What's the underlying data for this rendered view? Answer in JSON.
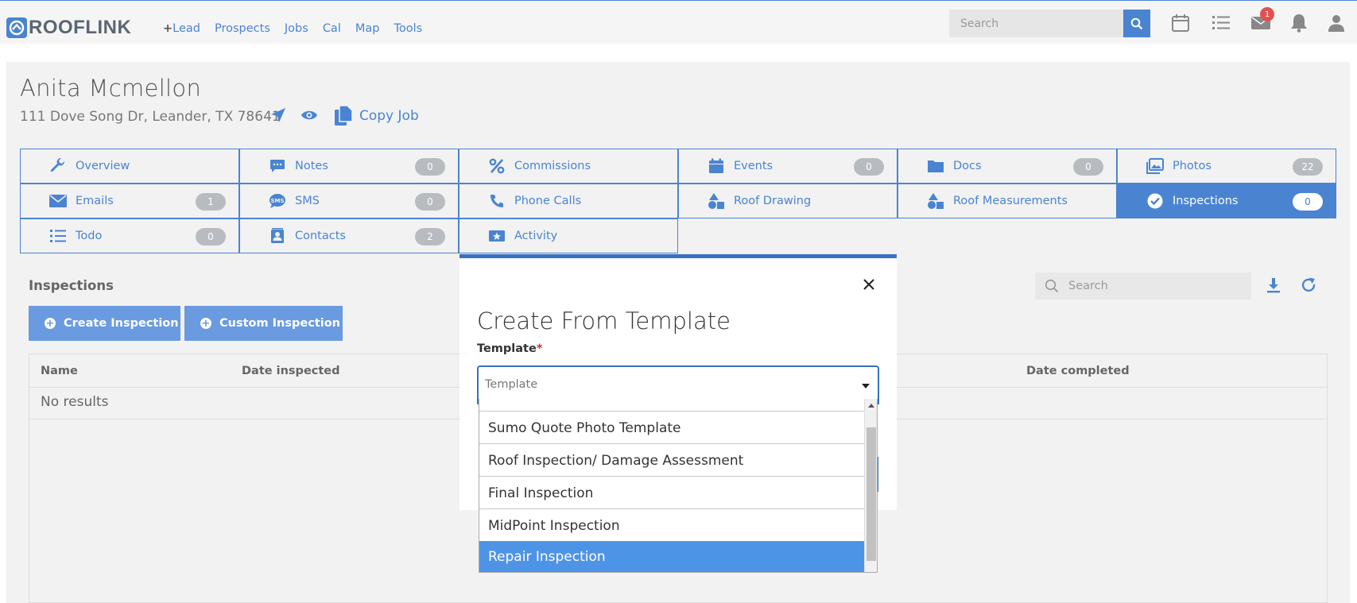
{
  "brand": {
    "name": "ROOFLINK",
    "color": "#4a84d1"
  },
  "nav": {
    "lead_plus": "+",
    "lead_label": "Lead",
    "items": [
      "Prospects",
      "Jobs",
      "Cal",
      "Map",
      "Tools"
    ]
  },
  "top_search": {
    "placeholder": "Search"
  },
  "notifications": {
    "mail_count": "1"
  },
  "customer": {
    "name": "Anita Mcmellon",
    "address": "111 Dove Song Dr, Leander, TX 78641",
    "copy_job_label": "Copy Job"
  },
  "tabs": [
    {
      "label": "Overview",
      "icon": "wrench-icon",
      "count": ""
    },
    {
      "label": "Notes",
      "icon": "chat-icon",
      "count": "0"
    },
    {
      "label": "Commissions",
      "icon": "percent-icon",
      "count": ""
    },
    {
      "label": "Events",
      "icon": "calendar-icon",
      "count": "0"
    },
    {
      "label": "Docs",
      "icon": "folder-icon",
      "count": "0"
    },
    {
      "label": "Photos",
      "icon": "images-icon",
      "count": "22"
    },
    {
      "label": "Emails",
      "icon": "envelope-icon",
      "count": "1"
    },
    {
      "label": "SMS",
      "icon": "sms-icon",
      "count": "0"
    },
    {
      "label": "Phone Calls",
      "icon": "phone-icon",
      "count": ""
    },
    {
      "label": "Roof Drawing",
      "icon": "shapes-icon",
      "count": ""
    },
    {
      "label": "Roof Measurements",
      "icon": "shapes-icon",
      "count": ""
    },
    {
      "label": "Inspections",
      "icon": "check-circle-icon",
      "count": "0",
      "active": true
    },
    {
      "label": "Todo",
      "icon": "list-icon",
      "count": "0"
    },
    {
      "label": "Contacts",
      "icon": "contact-card-icon",
      "count": "2"
    },
    {
      "label": "Activity",
      "icon": "star-ticket-icon",
      "count": ""
    }
  ],
  "inspections": {
    "title": "Inspections",
    "create_label": "Create Inspection",
    "custom_label": "Custom Inspection",
    "search_placeholder": "Search",
    "columns": [
      "Name",
      "Date inspected",
      "Date completed"
    ],
    "empty_text": "No results"
  },
  "modal": {
    "title": "Create From Template",
    "field_label": "Template",
    "required_mark": "*",
    "placeholder": "Template",
    "options": [
      "Sumo Quote Photo Template",
      "Roof Inspection/ Damage Assessment",
      "Final Inspection",
      "MidPoint Inspection",
      "Repair Inspection"
    ],
    "highlighted_option": "Repair Inspection"
  }
}
